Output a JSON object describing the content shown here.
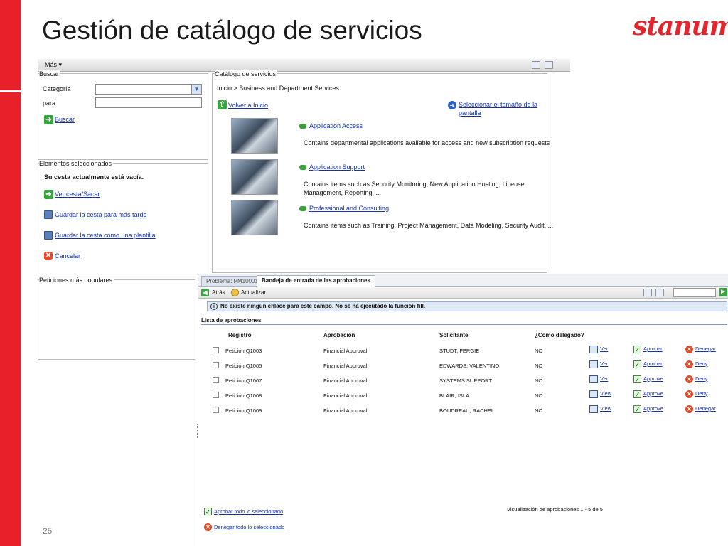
{
  "slide": {
    "title": "Gestión de catálogo de servicios",
    "logo": "stanum",
    "number": "25"
  },
  "top_toolbar": {
    "more_label": "Más ▾"
  },
  "search": {
    "legend": "Buscar",
    "category_label": "Categoría",
    "category_value": "",
    "for_label": "para",
    "for_value": "",
    "search_link": "Buscar"
  },
  "selected": {
    "legend": "Elementos seleccionados",
    "empty_msg": "Su cesta actualmente está vacía.",
    "links": [
      "Ver cesta/Sacar",
      "Guardar la cesta para más tarde",
      "Guardar la cesta como una plantilla",
      "Cancelar"
    ]
  },
  "popular": {
    "legend": "Peticiones más populares"
  },
  "catalog": {
    "legend": "Catálogo de servicios",
    "breadcrumb": "Inicio > Business and Department Services",
    "back_link": "Volver a Inicio",
    "size_link_1": "Seleccionar el tamaño de la",
    "size_link_2": "pantalla",
    "items": [
      {
        "title": "Application Access",
        "desc_1": "Contains departmental applications available for access and new subscription requests",
        "desc_2": ""
      },
      {
        "title": "Application Support",
        "desc_1": "Contains items such as Security Monitoring, New Application Hosting, License",
        "desc_2": "Management, Reporting, ..."
      },
      {
        "title": "Professional and Consulting",
        "desc_1": "Contains items such as Training, Project Management, Data Modeling, Security Audit, ...",
        "desc_2": ""
      }
    ]
  },
  "approvals": {
    "tabs": [
      "Problema: PM10001",
      "Bandeja de entrada de las aprobaciones"
    ],
    "back_label": "Atrás",
    "refresh_label": "Actualizar",
    "search_value": "",
    "info_message": "No existe ningún enlace para este campo. No se ha ejecutado la función fill.",
    "list_title": "Lista de aprobaciones",
    "columns": [
      "Registro",
      "Aprobación",
      "Solicitante",
      "¿Como delegado?"
    ],
    "rows": [
      {
        "registro": "Petición Q1003",
        "aprobacion": "Financial Approval",
        "solicitante": "STUDT, FERGIE",
        "delegado": "NO",
        "view": "Ver",
        "approve": "Aprobar",
        "deny": "Denegar"
      },
      {
        "registro": "Petición Q1005",
        "aprobacion": "Financial Approval",
        "solicitante": "EDWARDS, VALENTINO",
        "delegado": "NO",
        "view": "Ver",
        "approve": "Aprobar",
        "deny": "Deny"
      },
      {
        "registro": "Petición Q1007",
        "aprobacion": "Financial Approval",
        "solicitante": "SYSTEMS SUPPORT",
        "delegado": "NO",
        "view": "Ver",
        "approve": "Approve",
        "deny": "Deny"
      },
      {
        "registro": "Petición Q1008",
        "aprobacion": "Financial Approval",
        "solicitante": "BLAIR, ISLA",
        "delegado": "NO",
        "view": "View",
        "approve": "Approve",
        "deny": "Deny"
      },
      {
        "registro": "Petición Q1009",
        "aprobacion": "Financial Approval",
        "solicitante": "BOUDREAU, RACHEL",
        "delegado": "NO",
        "view": "View",
        "approve": "Approve",
        "deny": "Denegar"
      }
    ],
    "count_text": "Visualización de aprobaciones 1 - 5 de 5",
    "approve_all": "Aprobar todo lo seleccionado",
    "deny_all": "Denegar todo lo seleccionado"
  },
  "colors": {
    "accent_red": "#e8202a",
    "link_blue": "#1530a8",
    "info_bg": "#dfe8f5"
  }
}
